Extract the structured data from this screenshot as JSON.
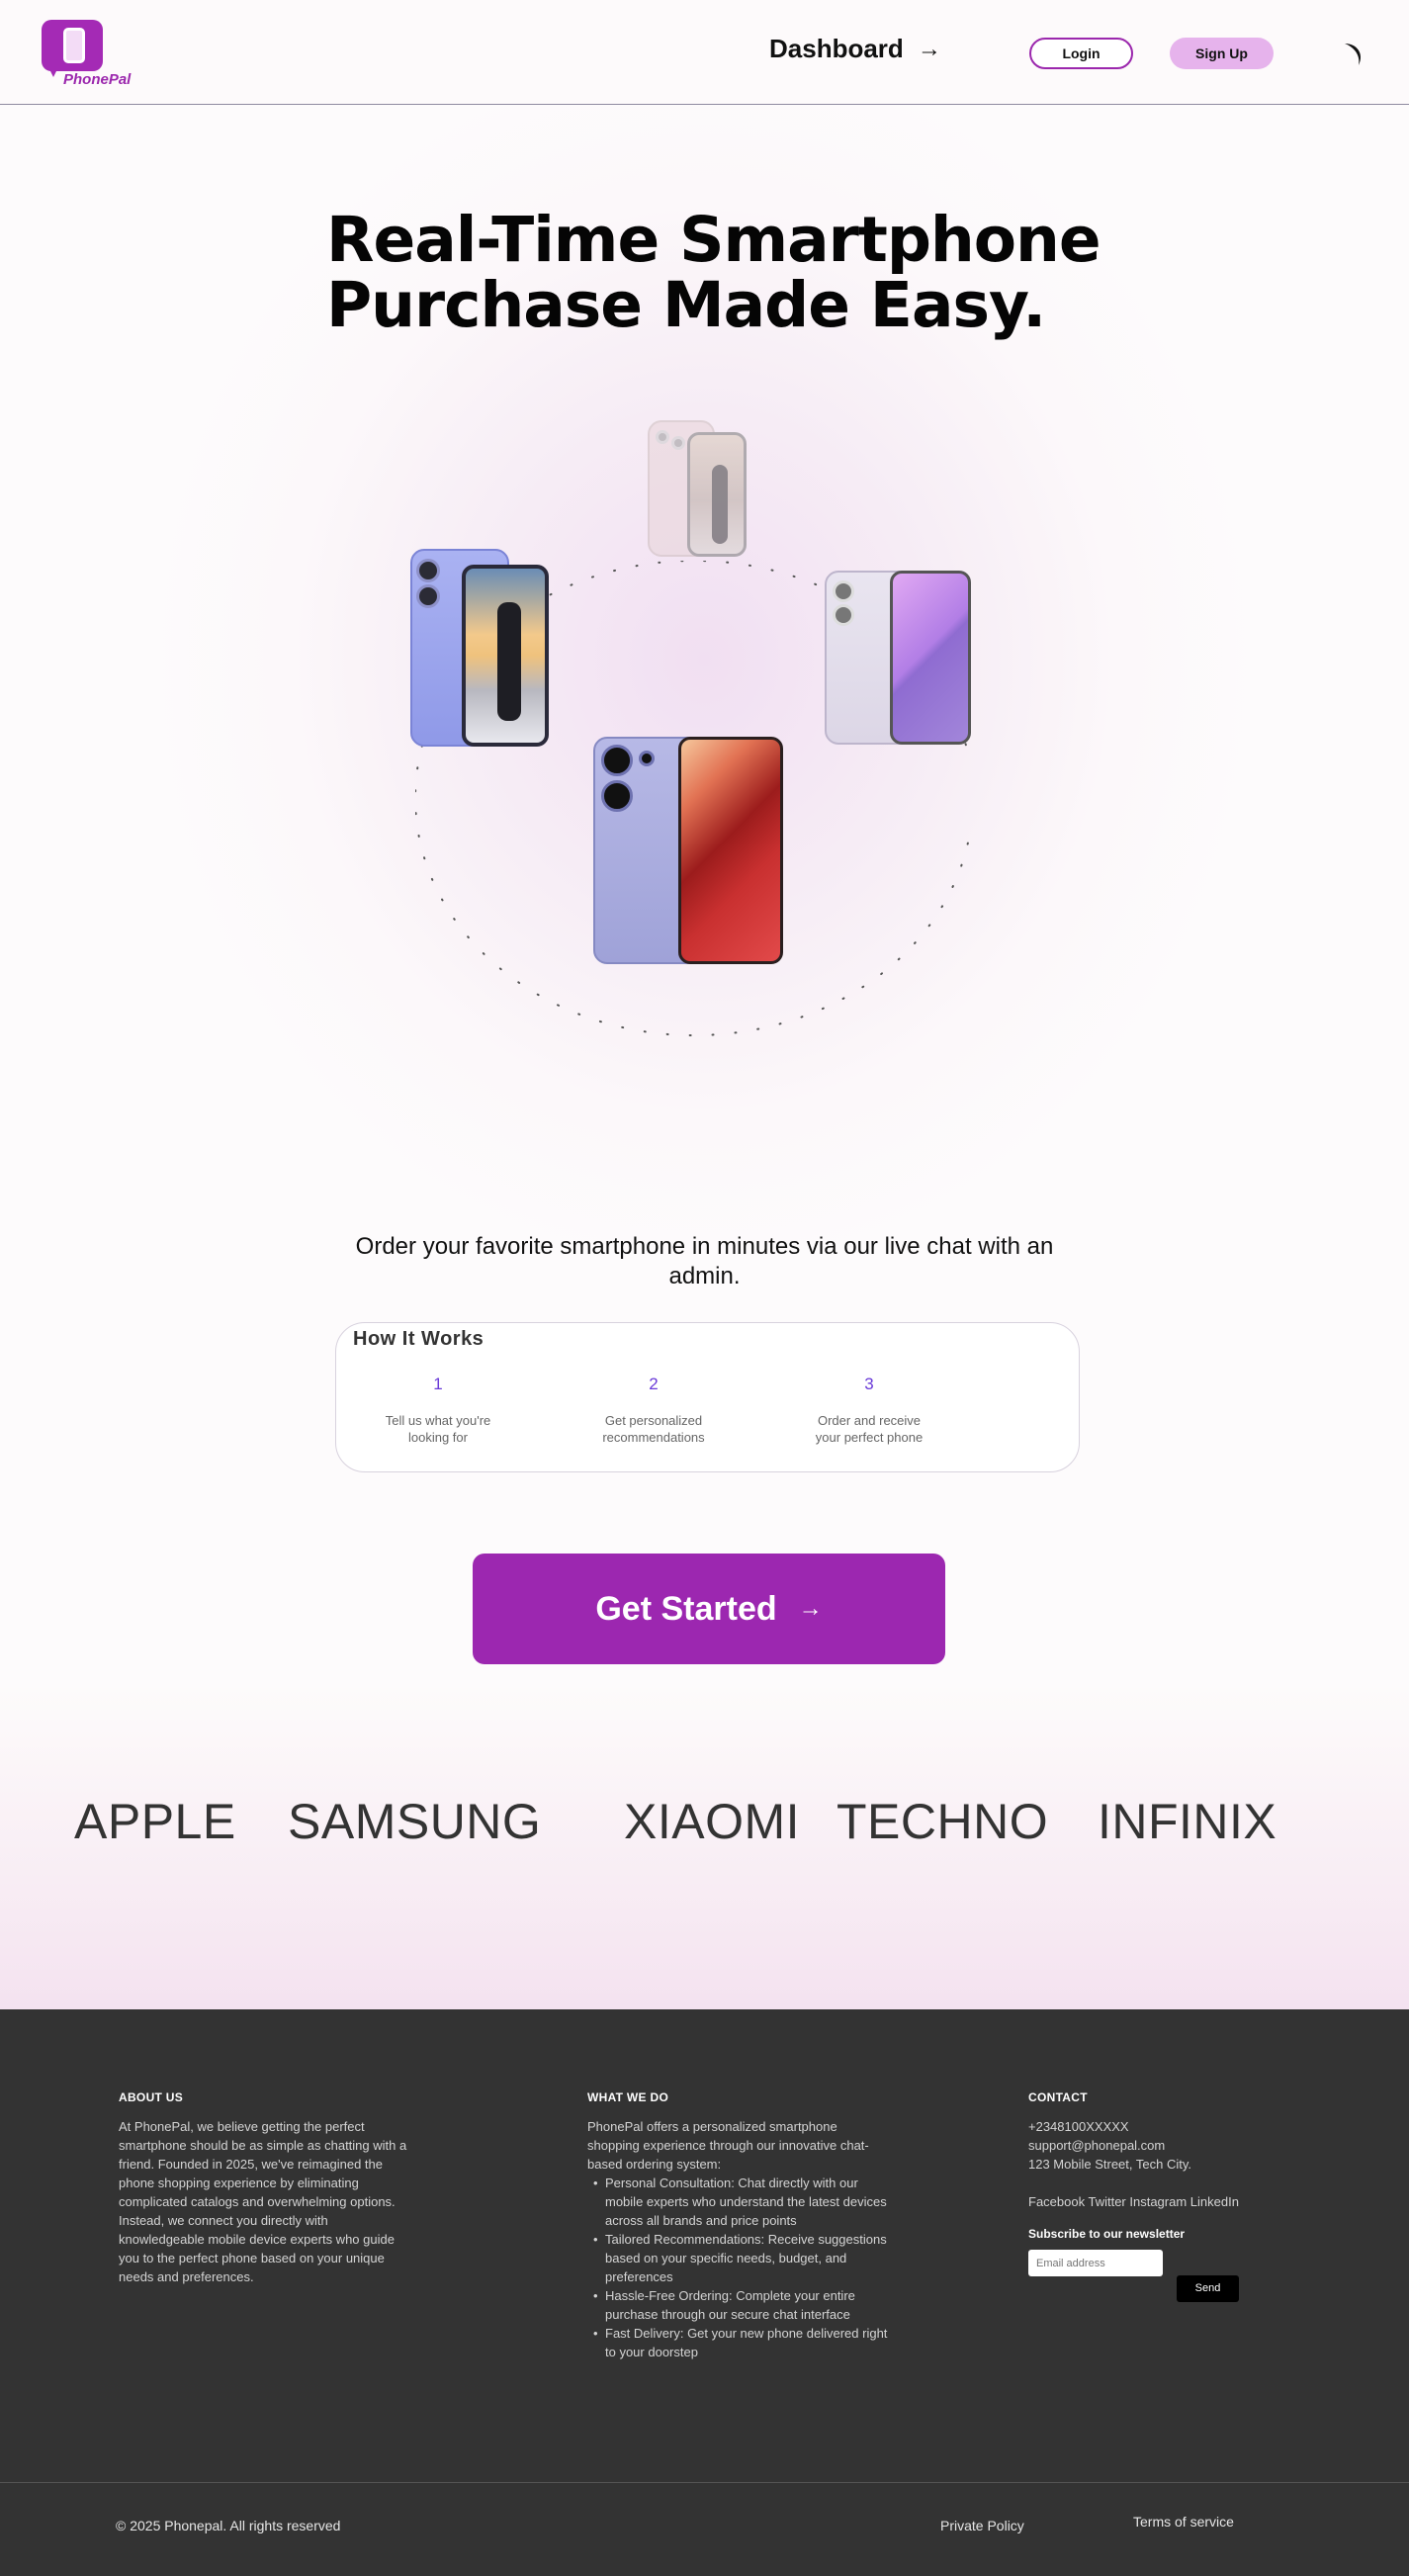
{
  "header": {
    "logo_text": "PhonePal",
    "dashboard_label": "Dashboard",
    "dashboard_arrow": "→",
    "login_label": "Login",
    "signup_label": "Sign Up"
  },
  "hero": {
    "title_line1": "Real-Time Smartphone",
    "title_line2": "Purchase Made Easy.",
    "tagline": "Order your favorite smartphone  in minutes via our live chat with an admin."
  },
  "how_it_works": {
    "title": "How It Works",
    "steps": [
      {
        "num": "1",
        "text": "Tell us what you're looking for"
      },
      {
        "num": "2",
        "text": "Get personalized recommendations"
      },
      {
        "num": "3",
        "text": "Order and receive your perfect phone"
      }
    ]
  },
  "cta": {
    "label": "Get Started",
    "arrow": "→"
  },
  "brands": [
    "APPLE",
    "SAMSUNG",
    "XIAOMI",
    "TECHNO",
    "INFINIX"
  ],
  "footer": {
    "about": {
      "title": "ABOUT US",
      "text": "At PhonePal, we believe getting the perfect smartphone should be as simple as chatting with a friend. Founded in 2025, we've reimagined the phone shopping experience by eliminating complicated catalogs and overwhelming options. Instead, we connect you directly with knowledgeable mobile device experts who guide you to the perfect phone based on your unique needs and preferences."
    },
    "what_we_do": {
      "title": "WHAT WE DO",
      "intro": "PhonePal offers a personalized smartphone shopping experience through our innovative chat-based ordering system:",
      "items": [
        "Personal Consultation: Chat directly with our mobile experts who understand the latest devices across all brands and price points",
        "Tailored Recommendations: Receive suggestions based on your specific needs, budget, and preferences",
        "Hassle-Free Ordering: Complete your entire purchase through our secure chat interface",
        "Fast Delivery: Get your new phone delivered right to your doorstep"
      ]
    },
    "contact": {
      "title": "CONTACT",
      "phone": "+2348100XXXXX",
      "email": "support@phonepal.com",
      "address": "123 Mobile Street, Tech City.",
      "social": "Facebook Twitter Instagram LinkedIn",
      "newsletter_title": "Subscribe to our newsletter",
      "email_placeholder": "Email address",
      "send_label": "Send"
    },
    "copyright": "© 2025 Phonepal. All rights reserved",
    "privacy": "Private Policy",
    "terms": "Terms of service"
  },
  "colors": {
    "brand_purple": "#9c27b0",
    "signup_pink": "#e6b3ec",
    "footer_bg": "#333333",
    "step_number": "#6a3bd8"
  }
}
